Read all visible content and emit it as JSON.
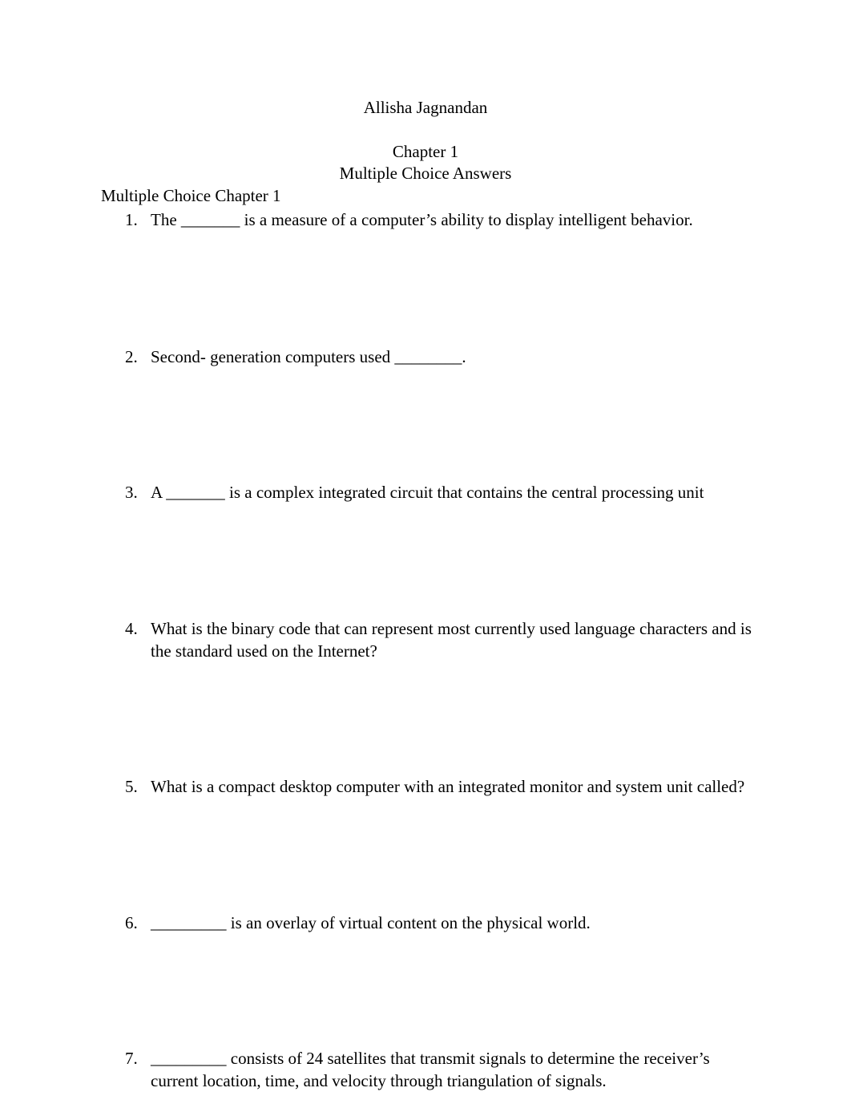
{
  "document": {
    "author": "Allisha Jagnandan",
    "title_line1": "Chapter 1",
    "title_line2": "Multiple Choice Answers",
    "section_heading": "Multiple Choice Chapter 1",
    "questions": [
      {
        "number": "1.",
        "text": "The _______ is a measure of a computer’s ability to display intelligent behavior."
      },
      {
        "number": "2.",
        "text": "Second- generation computers used ________."
      },
      {
        "number": "3.",
        "text": "A _______ is a complex integrated circuit that contains the central processing unit"
      },
      {
        "number": "4.",
        "text": "What is the binary code that can represent most currently used language characters and is the standard used on the Internet?"
      },
      {
        "number": "5.",
        "text": "What is a compact desktop computer with an integrated monitor and system unit called?"
      },
      {
        "number": "6.",
        "text": "_________ is an overlay of virtual content on the physical world."
      },
      {
        "number": "7.",
        "text": "_________ consists of 24 satellites that transmit signals to determine the receiver’s current location, time, and velocity through triangulation of signals."
      }
    ]
  }
}
